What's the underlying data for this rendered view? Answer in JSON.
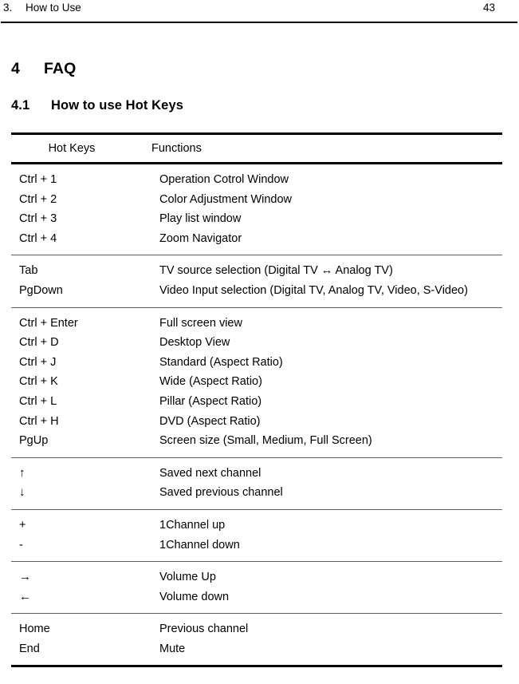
{
  "page_header": {
    "section_number": "3.",
    "section_title": "How to Use",
    "page_number": "43"
  },
  "headings": {
    "chapter_number": "4",
    "chapter_title": "FAQ",
    "section_number": "4.1",
    "section_title": "How to use Hot Keys"
  },
  "table": {
    "columns": [
      "Hot Keys",
      "Functions"
    ],
    "groups": [
      {
        "rows": [
          {
            "keys": "Ctrl + 1",
            "function": "Operation Cotrol Window"
          },
          {
            "keys": "Ctrl + 2",
            "function": "Color Adjustment Window"
          },
          {
            "keys": "Ctrl + 3",
            "function": "Play list window"
          },
          {
            "keys": "Ctrl + 4",
            "function": "Zoom Navigator"
          }
        ]
      },
      {
        "rows": [
          {
            "keys": "Tab",
            "function": "TV source selection (Digital TV ↔ Analog TV)"
          },
          {
            "keys": "PgDown",
            "function": "Video Input selection (Digital TV, Analog TV, Video, S-Video)"
          }
        ]
      },
      {
        "rows": [
          {
            "keys": "Ctrl + Enter",
            "function": "Full screen view"
          },
          {
            "keys": "Ctrl + D",
            "function": "Desktop View"
          },
          {
            "keys": "Ctrl + J",
            "function": "Standard (Aspect Ratio)"
          },
          {
            "keys": "Ctrl + K",
            "function": "Wide (Aspect Ratio)"
          },
          {
            "keys": "Ctrl + L",
            "function": "Pillar (Aspect Ratio)"
          },
          {
            "keys": "Ctrl + H",
            "function": "DVD (Aspect Ratio)"
          },
          {
            "keys": "PgUp",
            "function": "Screen size (Small, Medium, Full Screen)"
          }
        ]
      },
      {
        "rows": [
          {
            "keys": "↑",
            "function": "Saved next channel"
          },
          {
            "keys": "↓",
            "function": "Saved previous channel"
          }
        ]
      },
      {
        "rows": [
          {
            "keys": "+",
            "function": "1Channel up"
          },
          {
            "keys": "-",
            "function": "1Channel down"
          }
        ]
      },
      {
        "rows": [
          {
            "keys": "→",
            "function": "Volume Up"
          },
          {
            "keys": "←",
            "function": "Volume down"
          }
        ]
      },
      {
        "rows": [
          {
            "keys": "Home",
            "function": "Previous channel"
          },
          {
            "keys": "End",
            "function": "Mute"
          }
        ]
      }
    ]
  }
}
